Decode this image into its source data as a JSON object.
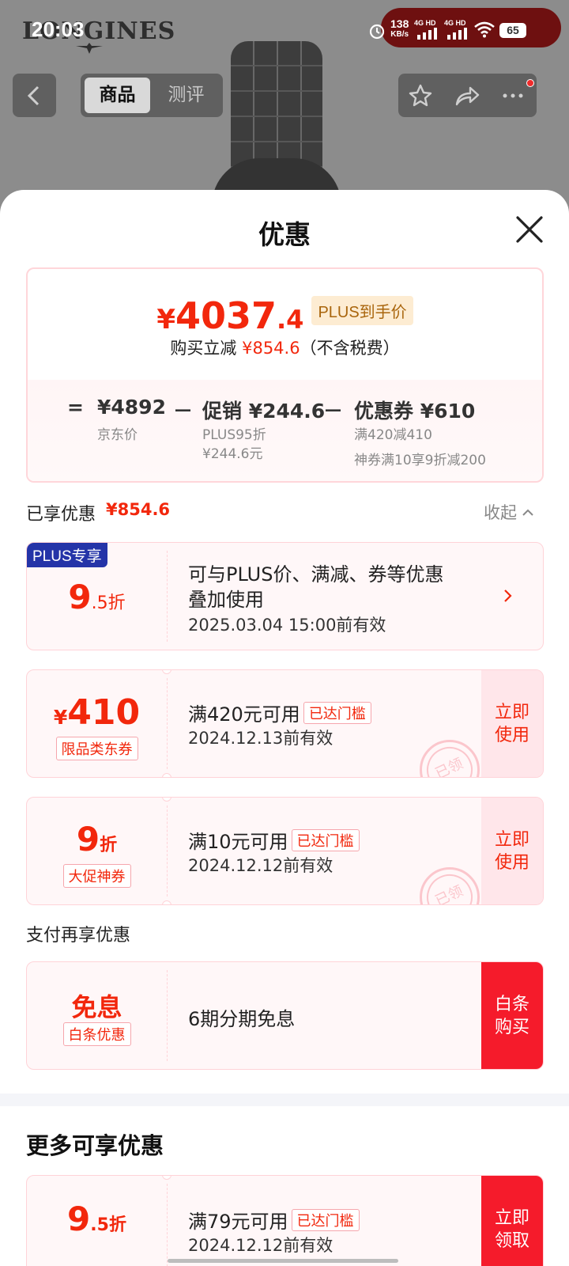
{
  "status_bar": {
    "time": "20:03",
    "speed": "138",
    "speed_unit": "KB/s",
    "sim1": "4G HD",
    "sim2": "4G HD",
    "battery": "65"
  },
  "background": {
    "brand_logo": "LONGINES",
    "tabs": [
      "商品",
      "测评"
    ]
  },
  "sheet": {
    "title": "优惠",
    "summary": {
      "currency": "¥",
      "price_int": "4037",
      "price_dec": ".4",
      "plus_tag": "PLUS到手价",
      "save_prefix": "购买立减",
      "save_amount": "¥854.6",
      "save_suffix": "（不含税费）",
      "formula": {
        "eq": "=",
        "jd_price": "¥4892",
        "jd_price_label": "京东价",
        "minus1": "－",
        "promo": "促销 ¥244.6",
        "promo_sub1": "PLUS95折",
        "promo_sub2": "¥244.6元",
        "minus2": "－",
        "coupon": "优惠券 ¥610",
        "coupon_sub1": "满420减410",
        "coupon_sub2": "神券满10享9折减200"
      }
    },
    "enjoyed_label": "已享优惠",
    "enjoyed_amount": "¥854.6",
    "collapse_label": "收起",
    "cards": [
      {
        "badge": "PLUS专享",
        "value_big": "9",
        "value_small": ".5折",
        "line1": "可与PLUS价、满减、券等优惠",
        "line2": "叠加使用",
        "line3": "2025.03.04 15:00前有效"
      },
      {
        "currency": "¥",
        "value_big": "410",
        "tag": "限品类东券",
        "line1": "满420元可用",
        "threshold": "已达门槛",
        "line2": "2024.12.13前有效",
        "action": "立即使用",
        "action_l1": "立即",
        "action_l2": "使用",
        "stamp": "已领"
      },
      {
        "value_big": "9",
        "value_small": "折",
        "tag": "大促神券",
        "line1": "满10元可用",
        "threshold": "已达门槛",
        "line2": "2024.12.12前有效",
        "action_l1": "立即",
        "action_l2": "使用",
        "stamp": "已领"
      }
    ],
    "pay_label": "支付再享优惠",
    "pay_card": {
      "value": "免息",
      "tag": "白条优惠",
      "line1": "6期分期免息",
      "action_l1": "白条",
      "action_l2": "购买"
    },
    "more_title": "更多可享优惠",
    "more_card": {
      "value_big": "9",
      "value_small": ".5折",
      "line1": "满79元可用",
      "threshold": "已达门槛",
      "line2": "2024.12.12前有效",
      "action_l1": "立即",
      "action_l2": "领取"
    }
  },
  "colors": {
    "accent_red": "#f2270c",
    "plus_blue": "#2434a8",
    "card_bg": "#fff7f8"
  }
}
